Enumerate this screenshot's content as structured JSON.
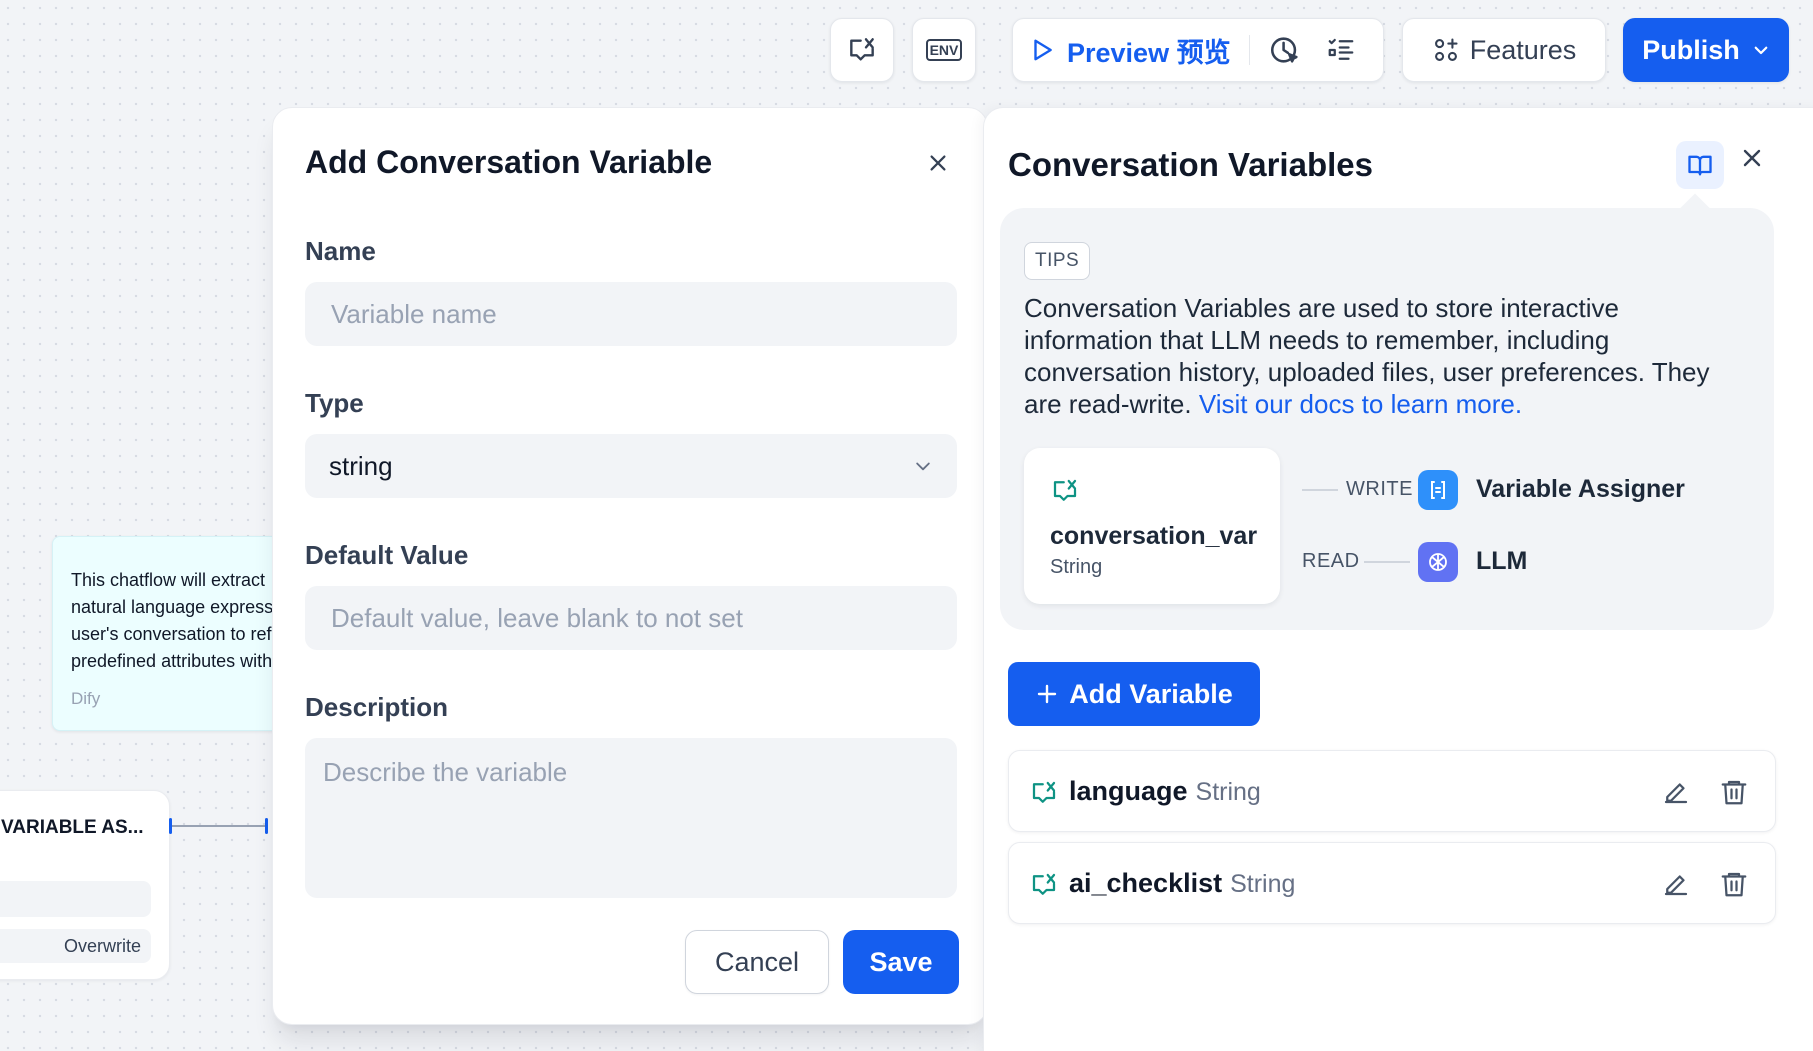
{
  "toolbar": {
    "conversation_icon": "conversation-variable-icon",
    "env_icon_text": "ENV",
    "preview_label": "Preview 预览",
    "features_label": "Features",
    "publish_label": "Publish"
  },
  "canvas": {
    "note": {
      "lines": [
        "This chatflow will extract",
        "natural language expressions",
        "user's conversation to refine",
        "predefined attributes with"
      ],
      "author": "Dify"
    },
    "node": {
      "title": "VARIABLE AS...",
      "tag": "Overwrite"
    }
  },
  "modal": {
    "title": "Add Conversation Variable",
    "name_label": "Name",
    "name_placeholder": "Variable name",
    "type_label": "Type",
    "type_value": "string",
    "default_label": "Default Value",
    "default_placeholder": "Default value, leave blank to not set",
    "description_label": "Description",
    "description_placeholder": "Describe the variable",
    "cancel_label": "Cancel",
    "save_label": "Save"
  },
  "panel": {
    "title": "Conversation Variables",
    "tips": {
      "badge": "TIPS",
      "text": "Conversation Variables are used to store interactive information that LLM needs to remember, including conversation history, uploaded files, user preferences. They are read-write.",
      "link": "Visit our docs to learn more.",
      "example_var_name": "conversation_var",
      "example_var_type": "String",
      "write_label": "WRITE",
      "read_label": "READ",
      "writer_name": "Variable Assigner",
      "reader_name": "LLM"
    },
    "add_variable_label": "Add Variable",
    "variables": [
      {
        "name": "language",
        "type": "String"
      },
      {
        "name": "ai_checklist",
        "type": "String"
      }
    ]
  },
  "colors": {
    "accent": "#155eef",
    "variable_icon": "#0e9384",
    "assigner_icon": "#2e90fa",
    "llm_icon": "#6172f3"
  }
}
